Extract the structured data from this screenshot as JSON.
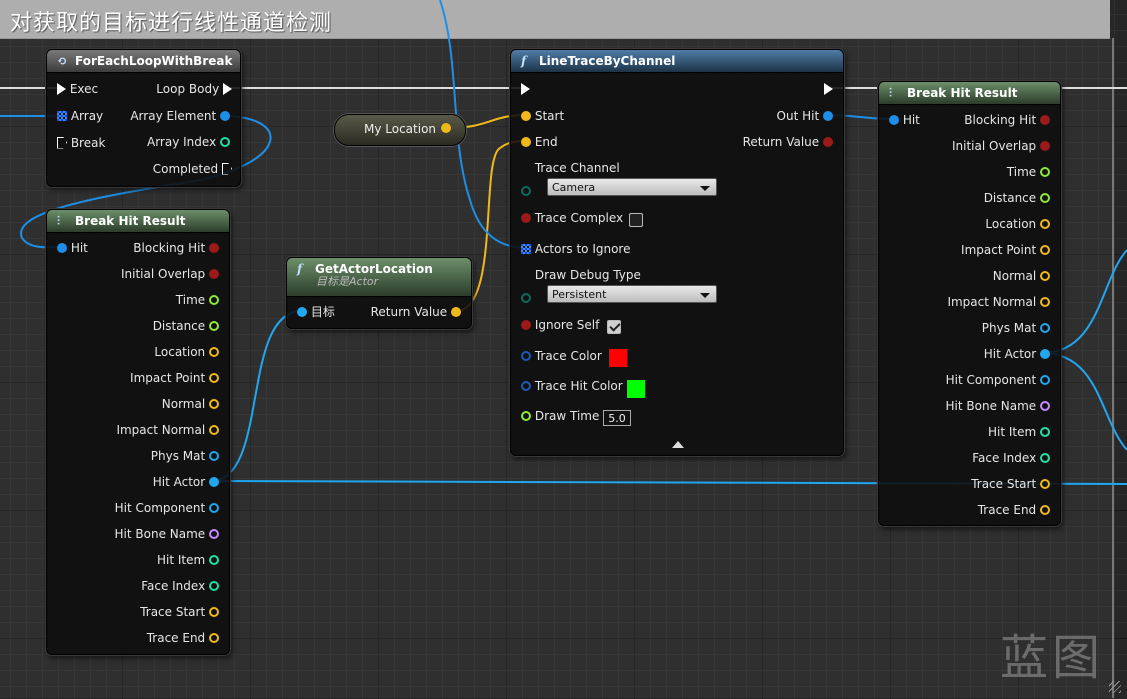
{
  "comment": {
    "title": "对获取的目标进行线性通道检测"
  },
  "colors": {
    "exec": "#ffffff",
    "struct": "#1e8fe6",
    "bool": "#9c1a1a",
    "float": "#8fe83a",
    "vector": "#f0b81a",
    "object": "#21a6f0",
    "name": "#c48aff",
    "int": "#1fe0a6",
    "byte": "#0c6b5a"
  },
  "foreach": {
    "title": "ForEachLoopWithBreak",
    "icon": "loop-icon",
    "inputs": [
      "Exec",
      "Array",
      "Break"
    ],
    "outputs": [
      "Loop Body",
      "Array Element",
      "Array Index",
      "Completed"
    ]
  },
  "break_left": {
    "title": "Break Hit Result",
    "input": "Hit",
    "outputs": [
      "Blocking Hit",
      "Initial Overlap",
      "Time",
      "Distance",
      "Location",
      "Impact Point",
      "Normal",
      "Impact Normal",
      "Phys Mat",
      "Hit Actor",
      "Hit Component",
      "Hit Bone Name",
      "Hit Item",
      "Face Index",
      "Trace Start",
      "Trace End"
    ]
  },
  "variable": {
    "label": "My Location"
  },
  "getactor": {
    "title": "GetActorLocation",
    "subtitle": "目标是Actor",
    "input": "目标",
    "output": "Return Value"
  },
  "linetrace": {
    "title": "LineTraceByChannel",
    "start": "Start",
    "end": "End",
    "out_hit": "Out Hit",
    "return_value": "Return Value",
    "trace_channel": "Trace Channel",
    "trace_channel_value": "Camera",
    "trace_complex": "Trace Complex",
    "trace_complex_checked": false,
    "actors_to_ignore": "Actors to Ignore",
    "draw_debug_type": "Draw Debug Type",
    "draw_debug_value": "Persistent",
    "ignore_self": "Ignore Self",
    "ignore_self_checked": true,
    "trace_color": "Trace Color",
    "trace_color_value": "#ff0000",
    "trace_hit_color": "Trace Hit Color",
    "trace_hit_color_value": "#00ff00",
    "draw_time": "Draw Time",
    "draw_time_value": "5.0"
  },
  "break_right": {
    "title": "Break Hit Result",
    "input": "Hit",
    "outputs": [
      "Blocking Hit",
      "Initial Overlap",
      "Time",
      "Distance",
      "Location",
      "Impact Point",
      "Normal",
      "Impact Normal",
      "Phys Mat",
      "Hit Actor",
      "Hit Component",
      "Hit Bone Name",
      "Hit Item",
      "Face Index",
      "Trace Start",
      "Trace End"
    ]
  },
  "watermark": "蓝图"
}
